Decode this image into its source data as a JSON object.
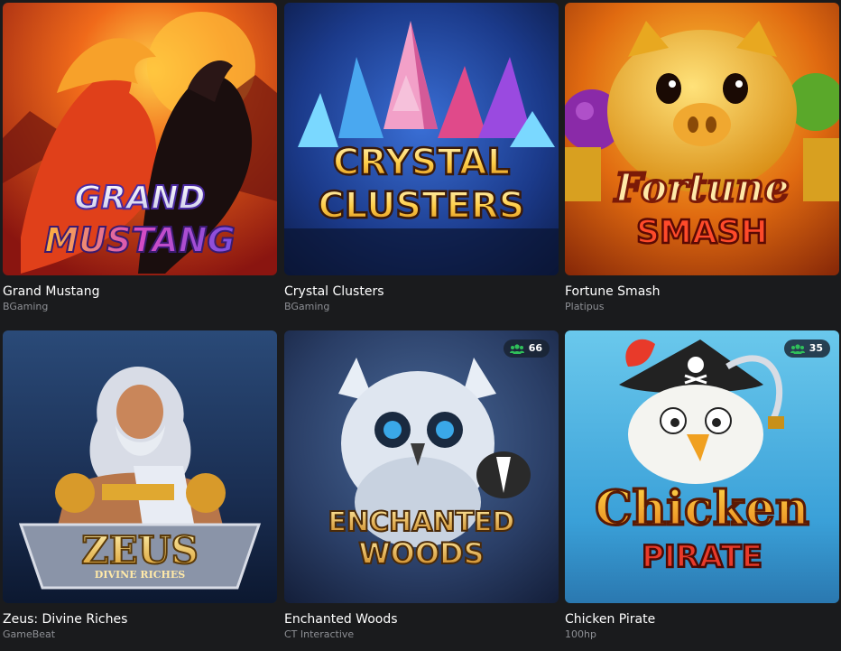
{
  "games": [
    {
      "title": "Grand Mustang",
      "provider": "BGaming",
      "art_line1": "GRAND",
      "art_line2": "MUSTANG"
    },
    {
      "title": "Crystal Clusters",
      "provider": "BGaming",
      "art_line1": "CRYSTAL",
      "art_line2": "CLUSTERS"
    },
    {
      "title": "Fortune Smash",
      "provider": "Platipus",
      "art_line1": "Fortune",
      "art_line2": "SMASH"
    },
    {
      "title": "Zeus: Divine Riches",
      "provider": "GameBeat",
      "art_line1": "ZEUS",
      "art_line2": "DIVINE RICHES"
    },
    {
      "title": "Enchanted Woods",
      "provider": "CT Interactive",
      "art_line1": "ENCHANTED",
      "art_line2": "WOODS",
      "players": "66"
    },
    {
      "title": "Chicken Pirate",
      "provider": "100hp",
      "art_line1": "Chicken",
      "art_line2": "PIRATE",
      "players": "35"
    }
  ],
  "colors": {
    "background": "#1a1b1d",
    "provider_text": "#8d8f94",
    "players_icon": "#2fbf5a"
  }
}
